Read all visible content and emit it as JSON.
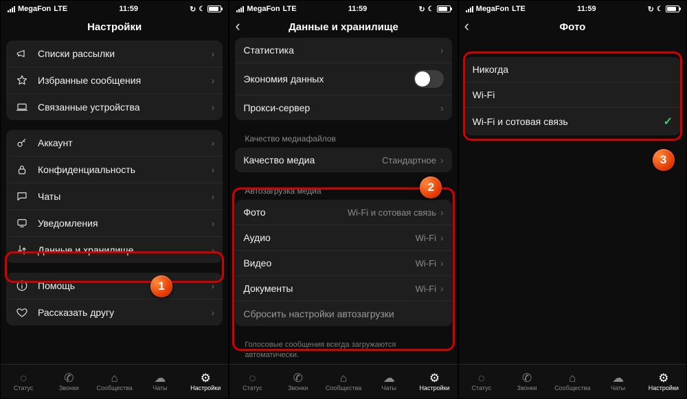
{
  "status": {
    "carrier": "MegaFon",
    "network": "LTE",
    "time": "11:59"
  },
  "tabs": {
    "status": "Статус",
    "calls": "Звонки",
    "communities": "Сообщества",
    "chats": "Чаты",
    "settings": "Настройки"
  },
  "screen1": {
    "title": "Настройки",
    "group1": {
      "broadcast": "Списки рассылки",
      "starred": "Избранные сообщения",
      "linked": "Связанные устройства"
    },
    "group2": {
      "account": "Аккаунт",
      "privacy": "Конфиденциальность",
      "chats": "Чаты",
      "notifications": "Уведомления",
      "storage": "Данные и хранилище"
    },
    "group3": {
      "help": "Помощь",
      "tell": "Рассказать другу"
    },
    "badge": "1"
  },
  "screen2": {
    "title": "Данные и хранилище",
    "rows": {
      "stats": "Статистика",
      "lowdata": "Экономия данных",
      "proxy": "Прокси-сервер"
    },
    "mediaQualityHeader": "Качество медиафайлов",
    "mediaQualityLabel": "Качество медиа",
    "mediaQualityValue": "Стандартное",
    "autoHeader": "Автозагрузка медиа",
    "auto": {
      "photoL": "Фото",
      "photoV": "Wi-Fi и сотовая связь",
      "audioL": "Аудио",
      "audioV": "Wi-Fi",
      "videoL": "Видео",
      "videoV": "Wi-Fi",
      "docsL": "Документы",
      "docsV": "Wi-Fi",
      "reset": "Сбросить настройки автозагрузки"
    },
    "footnote": "Голосовые сообщения всегда загружаются автоматически.",
    "badge": "2"
  },
  "screen3": {
    "title": "Фото",
    "options": {
      "never": "Никогда",
      "wifi": "Wi-Fi",
      "both": "Wi-Fi и сотовая связь"
    },
    "badge": "3"
  }
}
